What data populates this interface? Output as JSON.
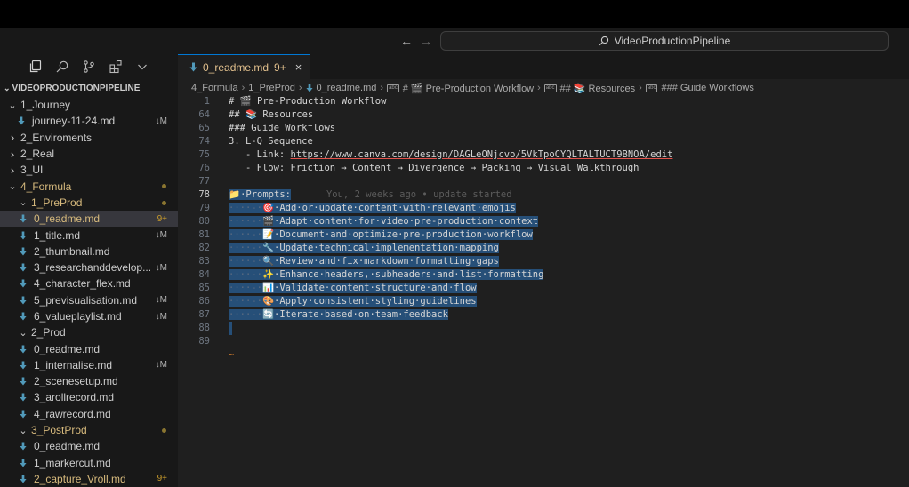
{
  "titlebar": {
    "back_icon": "arrow-left-icon",
    "forward_icon": "arrow-right-icon",
    "search_text": "VideoProductionPipeline"
  },
  "sidebar": {
    "root_label": "VIDEOPRODUCTIONPIPELINE",
    "items": [
      {
        "label": "1_Journey",
        "type": "folder",
        "open": true,
        "depth": 1
      },
      {
        "label": "journey-11-24.md",
        "type": "file",
        "depth": 2,
        "badge": "↓M"
      },
      {
        "label": "2_Enviroments",
        "type": "folder",
        "open": false,
        "depth": 1
      },
      {
        "label": "2_Real",
        "type": "folder",
        "open": false,
        "depth": 1
      },
      {
        "label": "3_UI",
        "type": "folder",
        "open": false,
        "depth": 1
      },
      {
        "label": "4_Formula",
        "type": "folder",
        "open": true,
        "depth": 1,
        "color": "yellow",
        "dot": true
      },
      {
        "label": "1_PreProd",
        "type": "folder",
        "open": true,
        "depth": 2,
        "color": "yellow",
        "dot": true
      },
      {
        "label": "0_readme.md",
        "type": "file",
        "depth": 3,
        "color": "yellow",
        "selected": true,
        "badge": "9+"
      },
      {
        "label": "1_title.md",
        "type": "file",
        "depth": 3,
        "badge": "↓M"
      },
      {
        "label": "2_thumbnail.md",
        "type": "file",
        "depth": 3
      },
      {
        "label": "3_researchanddevelop...",
        "type": "file",
        "depth": 3,
        "badge": "↓M"
      },
      {
        "label": "4_character_flex.md",
        "type": "file",
        "depth": 3
      },
      {
        "label": "5_previsualisation.md",
        "type": "file",
        "depth": 3,
        "badge": "↓M"
      },
      {
        "label": "6_valueplaylist.md",
        "type": "file",
        "depth": 3,
        "badge": "↓M"
      },
      {
        "label": "2_Prod",
        "type": "folder",
        "open": true,
        "depth": 2
      },
      {
        "label": "0_readme.md",
        "type": "file",
        "depth": 3
      },
      {
        "label": "1_internalise.md",
        "type": "file",
        "depth": 3,
        "badge": "↓M"
      },
      {
        "label": "2_scenesetup.md",
        "type": "file",
        "depth": 3
      },
      {
        "label": "3_arollrecord.md",
        "type": "file",
        "depth": 3
      },
      {
        "label": "4_rawrecord.md",
        "type": "file",
        "depth": 3
      },
      {
        "label": "3_PostProd",
        "type": "folder",
        "open": true,
        "depth": 2,
        "color": "yellow",
        "dot": true
      },
      {
        "label": "0_readme.md",
        "type": "file",
        "depth": 3
      },
      {
        "label": "1_markercut.md",
        "type": "file",
        "depth": 3
      },
      {
        "label": "2_capture_Vroll.md",
        "type": "file",
        "depth": 3,
        "color": "yellow",
        "badge": "9+"
      }
    ]
  },
  "tab": {
    "label": "0_readme.md",
    "badge": "9+",
    "close": "×"
  },
  "breadcrumb": [
    "4_Formula",
    "1_PreProd",
    "0_readme.md",
    "# 🎬 Pre-Production Workflow",
    "## 📚 Resources",
    "### Guide Workflows"
  ],
  "code": {
    "lines": [
      {
        "n": "1",
        "text": "# 🎬 Pre-Production Workflow"
      },
      {
        "n": "64",
        "text": "## 📚 Resources"
      },
      {
        "n": "65",
        "text": "### Guide Workflows"
      },
      {
        "n": "74",
        "text": "3. L-Q Sequence"
      },
      {
        "n": "75",
        "pre": "   - Link: ",
        "link": "https://www.canva.com/design/DAGLeONjcvo/5VkTpoCYQLTALTUCT9BNOA/edit"
      },
      {
        "n": "76",
        "text": "   - Flow: Friction → Content → Divergence → Packing → Visual Walkthrough"
      },
      {
        "n": "77",
        "text": ""
      },
      {
        "n": "78",
        "text": "📁·Prompts:",
        "active": true,
        "selected": true,
        "blame": "You, 2 weeks ago • update started"
      },
      {
        "n": "79",
        "selected": true,
        "indent": "····-·",
        "text": "🎯·Add·or·update·content·with·relevant·emojis"
      },
      {
        "n": "80",
        "selected": true,
        "indent": "····-·",
        "text": "🎬·Adapt·content·for·video·pre-production·context"
      },
      {
        "n": "81",
        "selected": true,
        "indent": "····-·",
        "text": "📝·Document·and·optimize·pre-production·workflow"
      },
      {
        "n": "82",
        "selected": true,
        "indent": "····-·",
        "text": "🔧·Update·technical·implementation·mapping"
      },
      {
        "n": "83",
        "selected": true,
        "indent": "····-·",
        "text": "🔍·Review·and·fix·markdown·formatting·gaps"
      },
      {
        "n": "84",
        "selected": true,
        "indent": "····-·",
        "text": "✨·Enhance·headers,·subheaders·and·list·formatting"
      },
      {
        "n": "85",
        "selected": true,
        "indent": "····-·",
        "text": "📊·Validate·content·structure·and·flow"
      },
      {
        "n": "86",
        "selected": true,
        "indent": "····-·",
        "text": "🎨·Apply·consistent·styling·guidelines"
      },
      {
        "n": "87",
        "selected": true,
        "indent": "····-·",
        "text": "🔄·Iterate·based·on·team·feedback"
      },
      {
        "n": "88",
        "selected": true,
        "text": ""
      },
      {
        "n": "89",
        "text": ""
      }
    ],
    "tail_marker": "~"
  },
  "colors": {
    "accent": "#0078d4",
    "modified": "#e2c08d",
    "selection": "#264f78",
    "markdown_icon": "#519aba"
  }
}
